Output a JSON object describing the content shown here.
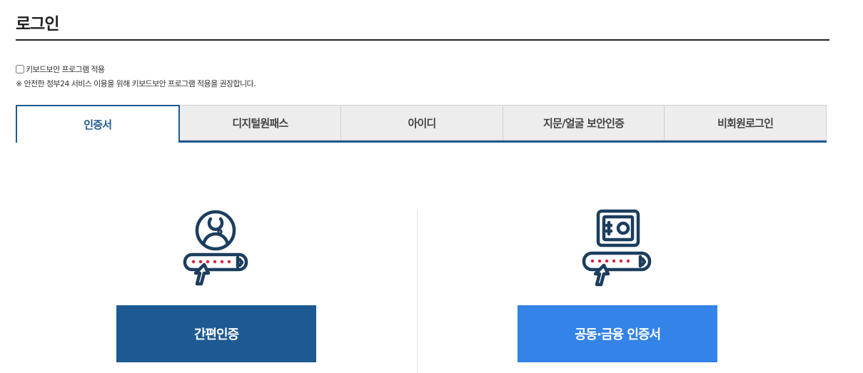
{
  "page": {
    "title": "로그인"
  },
  "keyboard_security": {
    "checkbox_label": "키보드보안 프로그램 적용",
    "checked": false,
    "notice": "※ 안전한 정부24 서비스 이용을 위해 키보드보안 프로그램 적용을 권장합니다."
  },
  "tabs": [
    {
      "label": "인증서",
      "active": true
    },
    {
      "label": "디지털원패스",
      "active": false
    },
    {
      "label": "아이디",
      "active": false
    },
    {
      "label": "지문/얼굴 보안인증",
      "active": false
    },
    {
      "label": "비회원로그인",
      "active": false
    }
  ],
  "options": [
    {
      "icon": "user-certificate-icon",
      "button_label": "간편인증",
      "button_color": "#1d5a92"
    },
    {
      "icon": "safe-certificate-icon",
      "button_label": "공동·금융 인증서",
      "button_color": "#3383e8"
    }
  ],
  "colors": {
    "accent": "#1e5a8f",
    "icon_stroke": "#1c3d5e",
    "password_dot": "#d9203f"
  }
}
